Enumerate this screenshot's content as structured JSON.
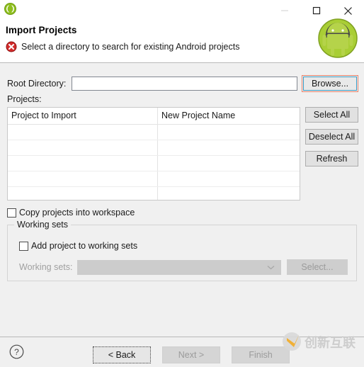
{
  "window": {
    "app_icon": "eclipse-icon",
    "controls": {
      "minimize": "minimize-icon",
      "maximize": "maximize-icon",
      "close": "close-icon"
    }
  },
  "header": {
    "title": "Import Projects",
    "message": "Select a directory to search for existing Android projects",
    "status_icon": "error-icon",
    "brand_icon": "android-logo"
  },
  "form": {
    "root_directory_label": "Root Directory:",
    "root_directory_value": "",
    "root_directory_placeholder": "",
    "browse_label": "Browse...",
    "projects_label": "Projects:"
  },
  "table": {
    "columns": [
      "Project to Import",
      "New Project Name"
    ],
    "rows": [
      [
        "",
        ""
      ],
      [
        "",
        ""
      ],
      [
        "",
        ""
      ],
      [
        "",
        ""
      ],
      [
        "",
        ""
      ]
    ]
  },
  "side_buttons": [
    {
      "label": "Select All"
    },
    {
      "label": "Deselect All"
    },
    {
      "label": "Refresh"
    }
  ],
  "options": {
    "copy_projects_label": "Copy projects into workspace",
    "copy_projects_checked": false
  },
  "working_sets": {
    "group_title": "Working sets",
    "add_project_label": "Add project to working sets",
    "add_project_checked": false,
    "combo_label": "Working sets:",
    "combo_value": "",
    "select_label": "Select...",
    "chevron_icon": "chevron-down-icon"
  },
  "footer": {
    "help_icon": "help-icon",
    "back_label": "< Back",
    "next_label": "Next >",
    "finish_label": "Finish",
    "watermark_text": "创新互联"
  },
  "colors": {
    "dialog_bg": "#f0f0f0",
    "header_bg": "#ffffff",
    "focus_outer": "#e8836b",
    "focus_inner": "#3a9bc4",
    "error_red": "#cc2222",
    "android_green": "#a4c639"
  }
}
